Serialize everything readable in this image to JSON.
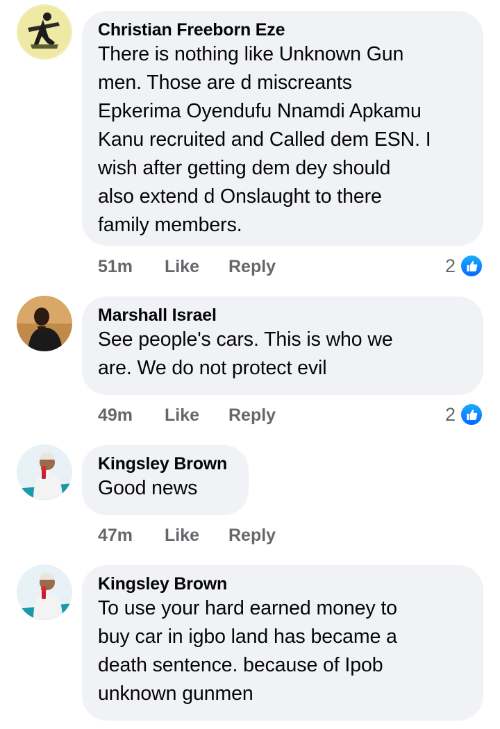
{
  "comments": [
    {
      "author": "Christian Freeborn Eze",
      "text": "There is nothing like Unknown Gun\nmen. Those are d miscreants\nEpkerima Oyendufu Nnamdi Apkamu\nKanu recruited and Called dem ESN. I\nwish after getting dem dey should\nalso extend d Onslaught to there\nfamily members.",
      "time": "51m",
      "like_label": "Like",
      "reply_label": "Reply",
      "reaction_count": "2"
    },
    {
      "author": "Marshall Israel",
      "text": "See people's cars. This is who we\nare. We do not protect evil",
      "time": "49m",
      "like_label": "Like",
      "reply_label": "Reply",
      "reaction_count": "2"
    },
    {
      "author": "Kingsley Brown",
      "text": "Good news",
      "time": "47m",
      "like_label": "Like",
      "reply_label": "Reply",
      "reaction_count": ""
    },
    {
      "author": "Kingsley Brown",
      "text": "To use your hard earned money to\nbuy car in igbo land has became a\ndeath sentence. because of Ipob\nunknown gunmen",
      "time": "",
      "like_label": "",
      "reply_label": "",
      "reaction_count": ""
    }
  ],
  "icons": {
    "reaction": "like-thumbs-up-icon",
    "avatar_1": "avatar-illustration",
    "avatar_2": "avatar-photo",
    "avatar_3": "avatar-photo"
  },
  "colors": {
    "bubble": "#f0f2f5",
    "meta_text": "#65676b",
    "like_blue": "#0866ff"
  }
}
